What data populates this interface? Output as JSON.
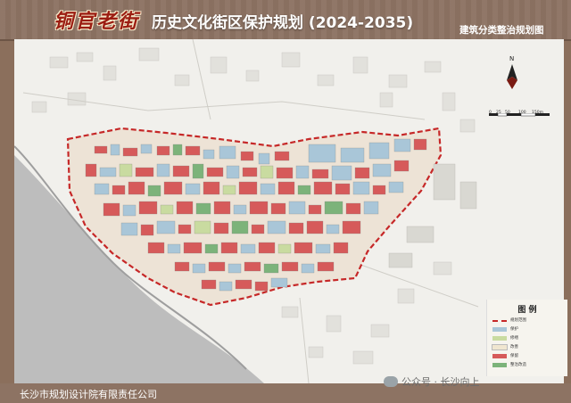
{
  "header": {
    "brand": "铜官老街",
    "title": "历史文化街区保护规划 (2024-2035)",
    "subtitle": "建筑分类整治规划图"
  },
  "footer": {
    "company": "长沙市规划设计院有限责任公司"
  },
  "watermark": {
    "text": "公众号 · 长沙向上"
  },
  "scalebar": {
    "labels": [
      "0",
      "25",
      "50",
      "100",
      "150m"
    ]
  },
  "legend": {
    "title": "图 例",
    "items": [
      {
        "label": "规划范围",
        "color": "#c62828"
      },
      {
        "label": "保护",
        "color": "#a9c6d8"
      },
      {
        "label": "修缮",
        "color": "#c9dba0"
      },
      {
        "label": "改善",
        "color": "#f0e6d0"
      },
      {
        "label": "保留",
        "color": "#d65a5a"
      },
      {
        "label": "整治改造",
        "color": "#7cb37a"
      }
    ]
  },
  "colors": {
    "protect": "#a9c6d8",
    "repair": "#c9dba0",
    "improve": "#f0e6d0",
    "retain": "#d65a5a",
    "renovate": "#7cb37a",
    "boundary": "#c62828",
    "water": "#bfbfbf"
  }
}
